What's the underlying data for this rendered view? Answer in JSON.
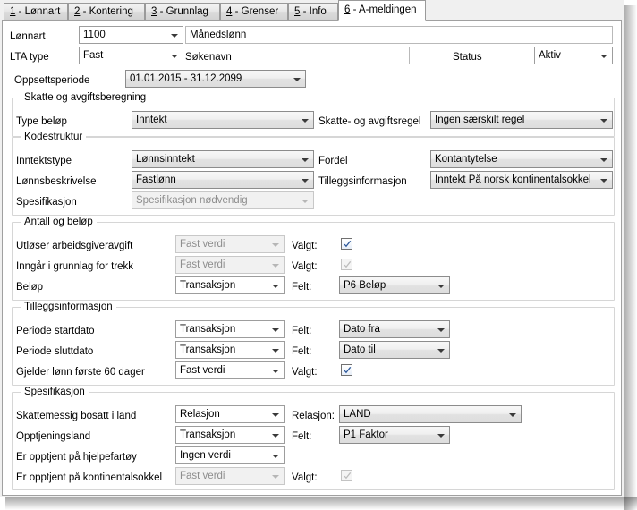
{
  "tabs": [
    {
      "accel": "1",
      "label": " - Lønnart",
      "active": false
    },
    {
      "accel": "2",
      "label": " - Kontering",
      "active": false
    },
    {
      "accel": "3",
      "label": " - Grunnlag",
      "active": false
    },
    {
      "accel": "4",
      "label": " - Grenser",
      "active": false
    },
    {
      "accel": "5",
      "label": " - Info",
      "active": false
    },
    {
      "accel": "6",
      "label": " - A-meldingen",
      "active": true
    }
  ],
  "header": {
    "lonnart_label": "Lønnart",
    "lonnart_value": "1100",
    "lonnart_name_value": "Månedslønn",
    "lta_label": "LTA type",
    "lta_value": "Fast",
    "sokenavn_label": "Søkenavn",
    "sokenavn_value": "",
    "status_label": "Status",
    "status_value": "Aktiv",
    "oppsettsperiode_label": "Oppsettsperiode",
    "oppsettsperiode_value": "01.01.2015 - 31.12.2099"
  },
  "skatt_group": {
    "title": "Skatte og avgiftsberegning",
    "type_belop_label": "Type beløp",
    "type_belop_value": "Inntekt",
    "regel_label": "Skatte- og avgiftsregel",
    "regel_value": "Ingen særskilt regel"
  },
  "kodestruktur_group": {
    "title": "Kodestruktur",
    "inntektstype_label": "Inntektstype",
    "inntektstype_value": "Lønnsinntekt",
    "fordel_label": "Fordel",
    "fordel_value": "Kontantytelse",
    "lonnsbeskrivelse_label": "Lønnsbeskrivelse",
    "lonnsbeskrivelse_value": "Fastlønn",
    "tilleggsinfo_label": "Tilleggsinformasjon",
    "tilleggsinfo_value": "Inntekt På norsk kontinentalsokkel",
    "spesifikasjon_label": "Spesifikasjon",
    "spesifikasjon_value": "Spesifikasjon nødvendig"
  },
  "antall_group": {
    "title": "Antall og beløp",
    "rows": [
      {
        "label": "Utløser arbeidsgiveravgift",
        "source": "Fast verdi",
        "source_disabled": true,
        "second_label": "Valgt:",
        "control": "checkbox",
        "checked": true,
        "checkbox_disabled": false
      },
      {
        "label": "Inngår i grunnlag for trekk",
        "source": "Fast verdi",
        "source_disabled": true,
        "second_label": "Valgt:",
        "control": "checkbox",
        "checked": true,
        "checkbox_disabled": true
      },
      {
        "label": "Beløp",
        "source": "Transaksjon",
        "source_disabled": false,
        "second_label": "Felt:",
        "control": "combo",
        "value": "P6  Beløp",
        "value_width": 120
      }
    ]
  },
  "tillegg_group": {
    "title": "Tilleggsinformasjon",
    "rows": [
      {
        "label": "Periode startdato",
        "source": "Transaksjon",
        "source_disabled": false,
        "second_label": "Felt:",
        "control": "combo",
        "value": "Dato fra",
        "value_width": 120
      },
      {
        "label": "Periode sluttdato",
        "source": "Transaksjon",
        "source_disabled": false,
        "second_label": "Felt:",
        "control": "combo",
        "value": "Dato til",
        "value_width": 120
      },
      {
        "label": "Gjelder lønn første 60 dager",
        "source": "Fast verdi",
        "source_disabled": false,
        "second_label": "Valgt:",
        "control": "checkbox",
        "checked": true,
        "checkbox_disabled": false
      }
    ]
  },
  "spesifikasjon_group": {
    "title": "Spesifikasjon",
    "rows": [
      {
        "label": "Skattemessig bosatt i land",
        "source": "Relasjon",
        "source_disabled": false,
        "second_label": "Relasjon:",
        "control": "combo",
        "value": "LAND",
        "value_width": 200
      },
      {
        "label": "Opptjeningsland",
        "source": "Transaksjon",
        "source_disabled": false,
        "second_label": "Felt:",
        "control": "combo",
        "value": "P1  Faktor",
        "value_width": 120
      },
      {
        "label": "Er opptjent på hjelpefartøy",
        "source": "Ingen verdi",
        "source_disabled": false,
        "second_label": "",
        "control": "none"
      },
      {
        "label": "Er opptjent på kontinentalsokkel",
        "source": "Fast verdi",
        "source_disabled": true,
        "second_label": "Valgt:",
        "control": "checkbox",
        "checked": true,
        "checkbox_disabled": true
      }
    ]
  },
  "colors": {
    "accent_check": "#2a5699",
    "disabled_check": "#b0b0b0",
    "window_bg": "#ffffff",
    "group_border": "#d6d6d6"
  }
}
